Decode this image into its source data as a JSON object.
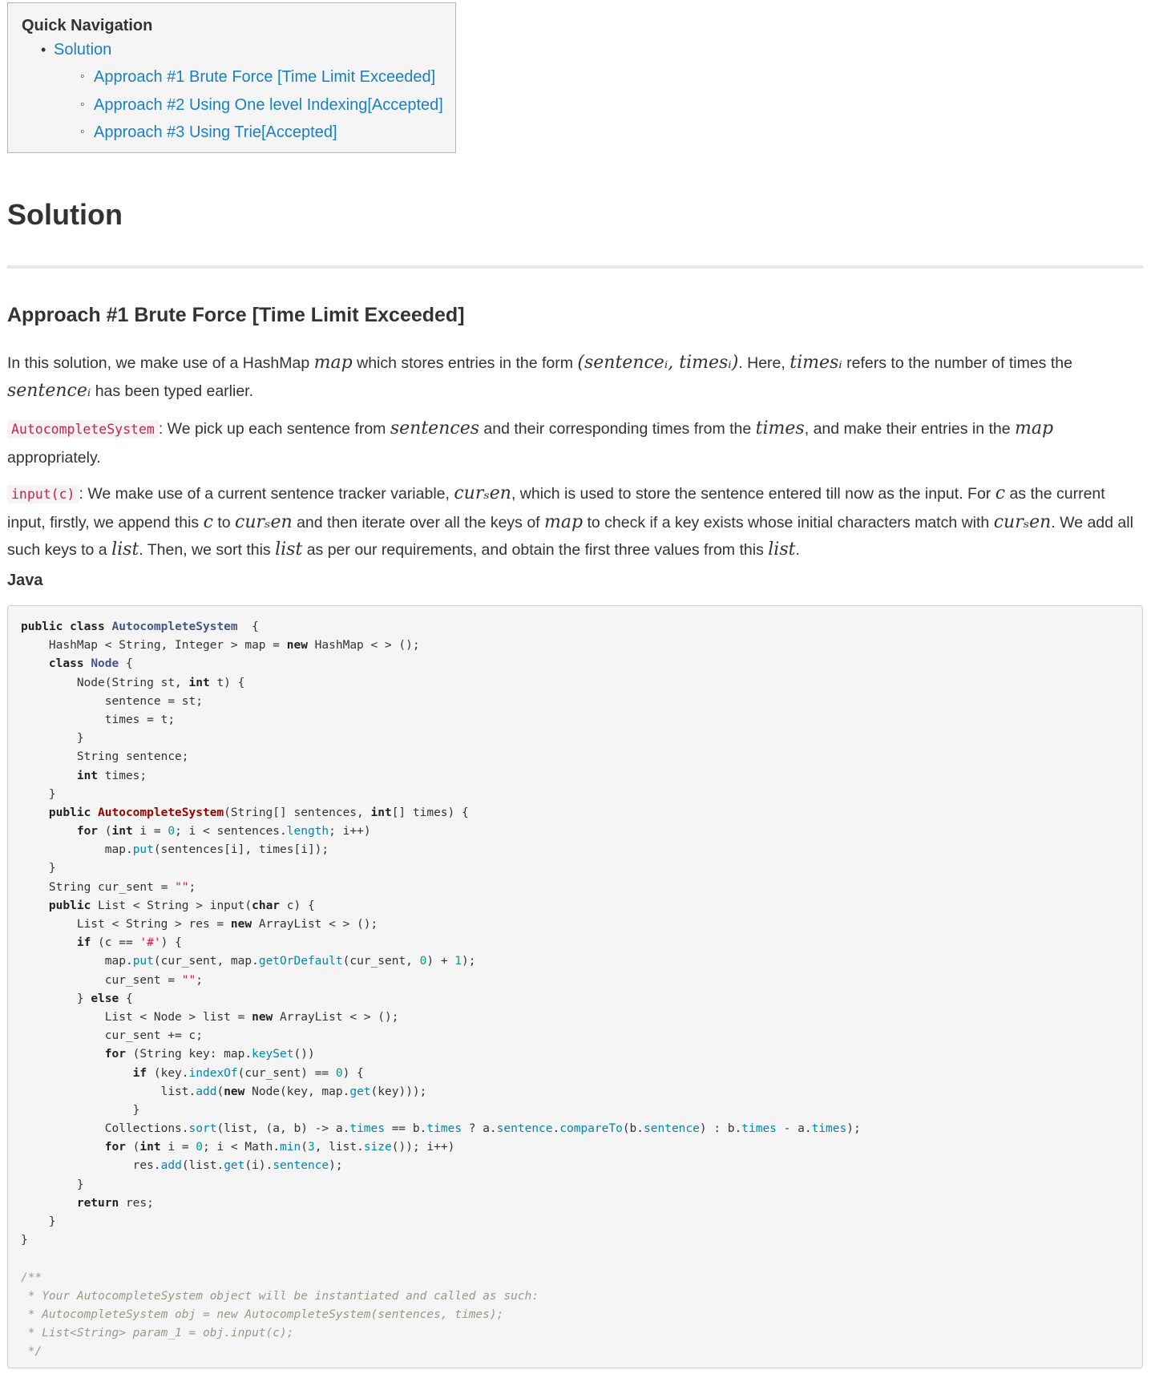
{
  "quick_nav": {
    "title": "Quick Navigation",
    "items": [
      {
        "label": "Solution",
        "children": [
          {
            "label": "Approach #1 Brute Force [Time Limit Exceeded]"
          },
          {
            "label": "Approach #2 Using One level Indexing[Accepted]"
          },
          {
            "label": "Approach #3 Using Trie[Accepted]"
          }
        ]
      }
    ]
  },
  "solution_heading": "Solution",
  "approach_heading": "Approach #1 Brute Force [Time Limit Exceeded]",
  "paragraph1": {
    "t1": "In this solution, we make use of a HashMap ",
    "m1": "map",
    "t2": " which stores entries in the form ",
    "m2": "(sentenceᵢ, timesᵢ)",
    "t3": ". Here, ",
    "m3": "timesᵢ",
    "t4": " refers to the number of times the ",
    "m4": "sentenceᵢ",
    "t5": " has been typed earlier."
  },
  "paragraph2": {
    "code": "AutocompleteSystem",
    "t1": ": We pick up each sentence from ",
    "m1": "sentences",
    "t2": " and their corresponding times from the ",
    "m2": "times",
    "t3": ", and make their entries in the ",
    "m3": "map",
    "t4": " appropriately."
  },
  "paragraph3": {
    "code": "input(c)",
    "t1": ": We make use of a current sentence tracker variable, ",
    "m1": "curₛen",
    "t2": ", which is used to store the sentence entered till now as the input. For ",
    "m2": "c",
    "t3": " as the current input, firstly, we append this ",
    "m3": "c",
    "t4": " to ",
    "m4": "curₛen",
    "t5": " and then iterate over all the keys of ",
    "m5": "map",
    "t6": " to check if a key exists whose initial characters match with ",
    "m6": "curₛen",
    "t7": ". We add all such keys to a ",
    "m7": "list",
    "t8": ". Then, we sort this ",
    "m8": "list",
    "t9": " as per our requirements, and obtain the first three values from this ",
    "m9": "list",
    "t10": "."
  },
  "language_label": "Java",
  "code_lines": [
    [
      [
        "kw",
        "public class "
      ],
      [
        "cls",
        "AutocompleteSystem"
      ],
      [
        "",
        "  {"
      ]
    ],
    [
      [
        "",
        "    HashMap < String, Integer > map = "
      ],
      [
        "kw",
        "new"
      ],
      [
        "",
        " HashMap < > ();"
      ]
    ],
    [
      [
        "kw",
        "    class "
      ],
      [
        "cls",
        "Node"
      ],
      [
        "",
        " {"
      ]
    ],
    [
      [
        "",
        "        Node(String st, "
      ],
      [
        "kw",
        "int"
      ],
      [
        "",
        " t) {"
      ]
    ],
    [
      [
        "",
        "            sentence = st;"
      ]
    ],
    [
      [
        "",
        "            times = t;"
      ]
    ],
    [
      [
        "",
        "        }"
      ]
    ],
    [
      [
        "",
        "        String sentence;"
      ]
    ],
    [
      [
        "kw",
        "        int"
      ],
      [
        "",
        " times;"
      ]
    ],
    [
      [
        "",
        "    }"
      ]
    ],
    [
      [
        "kw",
        "    public "
      ],
      [
        "fn",
        "AutocompleteSystem"
      ],
      [
        "",
        "(String[] sentences, "
      ],
      [
        "kw",
        "int"
      ],
      [
        "",
        "[] times) {"
      ]
    ],
    [
      [
        "kw",
        "        for"
      ],
      [
        "",
        " ("
      ],
      [
        "kw",
        "int"
      ],
      [
        "",
        " i = "
      ],
      [
        "num",
        "0"
      ],
      [
        "",
        "; i < sentences."
      ],
      [
        "mem",
        "length"
      ],
      [
        "",
        "; i++)"
      ]
    ],
    [
      [
        "",
        "            map."
      ],
      [
        "mem",
        "put"
      ],
      [
        "",
        "(sentences[i], times[i]);"
      ]
    ],
    [
      [
        "",
        "    }"
      ]
    ],
    [
      [
        "",
        "    String cur_sent = "
      ],
      [
        "str",
        "\"\""
      ],
      [
        "",
        ";"
      ]
    ],
    [
      [
        "kw",
        "    public"
      ],
      [
        "",
        " List < String > input("
      ],
      [
        "kw",
        "char"
      ],
      [
        "",
        " c) {"
      ]
    ],
    [
      [
        "",
        "        List < String > res = "
      ],
      [
        "kw",
        "new"
      ],
      [
        "",
        " ArrayList < > ();"
      ]
    ],
    [
      [
        "kw",
        "        if"
      ],
      [
        "",
        " (c == "
      ],
      [
        "str",
        "'#'"
      ],
      [
        "",
        ") {"
      ]
    ],
    [
      [
        "",
        "            map."
      ],
      [
        "mem",
        "put"
      ],
      [
        "",
        "(cur_sent, map."
      ],
      [
        "mem",
        "getOrDefault"
      ],
      [
        "",
        "(cur_sent, "
      ],
      [
        "num",
        "0"
      ],
      [
        "",
        ") + "
      ],
      [
        "num",
        "1"
      ],
      [
        "",
        ");"
      ]
    ],
    [
      [
        "",
        "            cur_sent = "
      ],
      [
        "str",
        "\"\""
      ],
      [
        "",
        ";"
      ]
    ],
    [
      [
        "",
        "        } "
      ],
      [
        "kw",
        "else"
      ],
      [
        "",
        " {"
      ]
    ],
    [
      [
        "",
        "            List < Node > list = "
      ],
      [
        "kw",
        "new"
      ],
      [
        "",
        " ArrayList < > ();"
      ]
    ],
    [
      [
        "",
        "            cur_sent += c;"
      ]
    ],
    [
      [
        "kw",
        "            for"
      ],
      [
        "",
        " (String key: map."
      ],
      [
        "mem",
        "keySet"
      ],
      [
        "",
        "())"
      ]
    ],
    [
      [
        "kw",
        "                if"
      ],
      [
        "",
        " (key."
      ],
      [
        "mem",
        "indexOf"
      ],
      [
        "",
        "(cur_sent) == "
      ],
      [
        "num",
        "0"
      ],
      [
        "",
        ") {"
      ]
    ],
    [
      [
        "",
        "                    list."
      ],
      [
        "mem",
        "add"
      ],
      [
        "",
        "("
      ],
      [
        "kw",
        "new"
      ],
      [
        "",
        " Node(key, map."
      ],
      [
        "mem",
        "get"
      ],
      [
        "",
        "(key)));"
      ]
    ],
    [
      [
        "",
        "                }"
      ]
    ],
    [
      [
        "",
        "            Collections."
      ],
      [
        "mem",
        "sort"
      ],
      [
        "",
        "(list, (a, b) -> a."
      ],
      [
        "mem",
        "times"
      ],
      [
        "",
        " == b."
      ],
      [
        "mem",
        "times"
      ],
      [
        "",
        " ? a."
      ],
      [
        "mem",
        "sentence"
      ],
      [
        "",
        "."
      ],
      [
        "mem",
        "compareTo"
      ],
      [
        "",
        "(b."
      ],
      [
        "mem",
        "sentence"
      ],
      [
        "",
        ") : b."
      ],
      [
        "mem",
        "times"
      ],
      [
        "",
        " - a."
      ],
      [
        "mem",
        "times"
      ],
      [
        "",
        ");"
      ]
    ],
    [
      [
        "kw",
        "            for"
      ],
      [
        "",
        " ("
      ],
      [
        "kw",
        "int"
      ],
      [
        "",
        " i = "
      ],
      [
        "num",
        "0"
      ],
      [
        "",
        "; i < Math."
      ],
      [
        "mem",
        "min"
      ],
      [
        "",
        "("
      ],
      [
        "num",
        "3"
      ],
      [
        "",
        ", list."
      ],
      [
        "mem",
        "size"
      ],
      [
        "",
        "()); i++)"
      ]
    ],
    [
      [
        "",
        "                res."
      ],
      [
        "mem",
        "add"
      ],
      [
        "",
        "(list."
      ],
      [
        "mem",
        "get"
      ],
      [
        "",
        "(i)."
      ],
      [
        "mem",
        "sentence"
      ],
      [
        "",
        ");"
      ]
    ],
    [
      [
        "",
        "        }"
      ]
    ],
    [
      [
        "kw",
        "        return"
      ],
      [
        "",
        " res;"
      ]
    ],
    [
      [
        "",
        "    }"
      ]
    ],
    [
      [
        "",
        "}"
      ]
    ],
    [
      [
        "",
        ""
      ]
    ],
    [
      [
        "cmt",
        "/**"
      ]
    ],
    [
      [
        "cmt",
        " * Your AutocompleteSystem object will be instantiated and called as such:"
      ]
    ],
    [
      [
        "cmt",
        " * AutocompleteSystem obj = new AutocompleteSystem(sentences, times);"
      ]
    ],
    [
      [
        "cmt",
        " * List<String> param_1 = obj.input(c);"
      ]
    ],
    [
      [
        "cmt",
        " */"
      ]
    ]
  ]
}
